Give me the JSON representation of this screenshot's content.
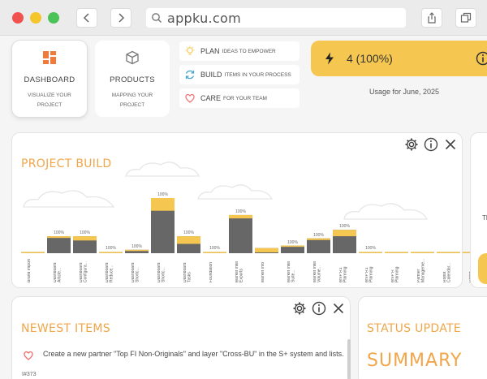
{
  "browser": {
    "url": "appku.com"
  },
  "nav": {
    "dashboard": {
      "title": "DASHBOARD",
      "subtitle_1": "VISUALIZE YOUR",
      "subtitle_2": "PROJECT"
    },
    "products": {
      "title": "PRODUCTS",
      "subtitle_1": "MAPPING YOUR",
      "subtitle_2": "PROJECT"
    }
  },
  "actions": [
    {
      "main": "PLAN",
      "sub": "IDEAS TO EMPOWER"
    },
    {
      "main": "BUILD",
      "sub": "ITEMS IN YOUR PROCESS"
    },
    {
      "main": "CARE",
      "sub": "FOR YOUR TEAM"
    }
  ],
  "usage": {
    "value": "4 (100%)",
    "label": "Usage for June, 2025"
  },
  "project_build": {
    "title": "PROJECT BUILD"
  },
  "chart_data": {
    "type": "bar",
    "categories": [
      "Brand Import",
      "Dashboard Article...",
      "Dashboard Configura...",
      "Dashboard Reduce...",
      "Dashboard Shortc...",
      "Dashboard Shortc...",
      "Dashboard Tasks",
      "Foundation",
      "Market Intel Exports",
      "Market Info",
      "Market Intel Suite...",
      "Market Intel Volume...",
      "MVP R1 Planning",
      "MVP R1 Planning",
      "MVP R Planning",
      "Partner Manageme...",
      "Robot Calendar...",
      "Robot Calendar..."
    ],
    "stack_total": [
      3,
      40,
      40,
      3,
      8,
      130,
      40,
      3,
      90,
      12,
      18,
      35,
      55,
      3,
      3,
      3,
      3,
      3
    ],
    "stack_top": [
      2,
      4,
      10,
      1,
      2,
      30,
      18,
      1,
      8,
      10,
      3,
      4,
      15,
      1,
      2,
      2,
      2,
      2
    ],
    "value_labels": [
      "",
      "100%",
      "100%",
      "100%",
      "100%",
      "100%",
      "100%",
      "100%",
      "100%",
      "",
      "100%",
      "100%",
      "100%",
      "100%",
      "",
      "",
      "",
      ""
    ]
  },
  "newest": {
    "title": "NEWEST ITEMS",
    "item_text": "Create a new partner \"Top FI Non-Originals\" and layer \"Cross-BU\" in the S+ system and lists.",
    "item_id": "I#373"
  },
  "status": {
    "title": "STATUS UPDATE",
    "summary": "SUMMARY"
  },
  "right_panel": {
    "partial_text": "Th"
  },
  "colors": {
    "accent": "#f0a64a",
    "yellow": "#f6c750",
    "bar": "#676767"
  }
}
